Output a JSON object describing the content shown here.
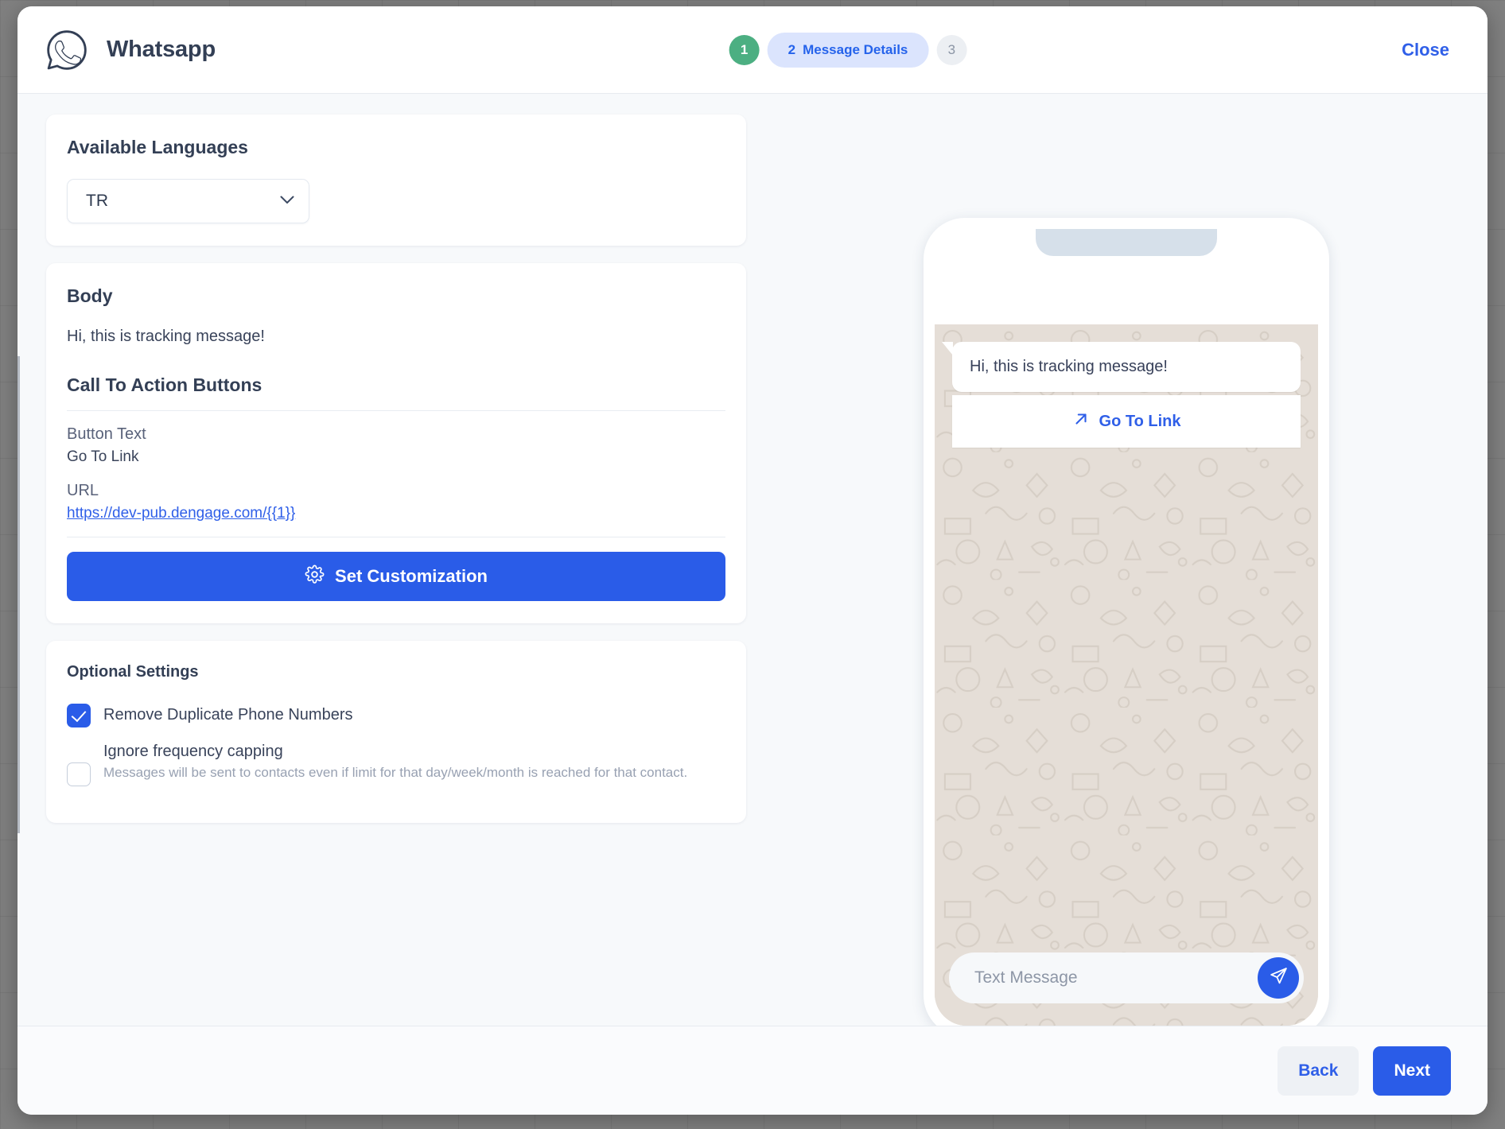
{
  "header": {
    "title": "Whatsapp",
    "logo_icon": "whatsapp-icon",
    "close_label": "Close",
    "steps": [
      {
        "number": "1",
        "label": "",
        "state": "done"
      },
      {
        "number": "2",
        "label": "Message Details",
        "state": "active"
      },
      {
        "number": "3",
        "label": "",
        "state": "idle"
      }
    ]
  },
  "languages": {
    "title": "Available Languages",
    "selected": "TR",
    "chevron_icon": "chevron-down-icon"
  },
  "body_card": {
    "title": "Body",
    "text": "Hi, this is tracking message!",
    "cta_heading": "Call To Action Buttons",
    "button_text_label": "Button Text",
    "button_text_value": "Go To Link",
    "url_label": "URL",
    "url_value": "https://dev-pub.dengage.com/{{1}}",
    "customization_button": "Set Customization",
    "customization_icon": "gear-icon"
  },
  "optional": {
    "title": "Optional Settings",
    "items": [
      {
        "label": "Remove Duplicate Phone Numbers",
        "sub": "",
        "checked": true
      },
      {
        "label": "Ignore frequency capping",
        "sub": "Messages will be sent to contacts even if limit for that day/week/month is reached for that contact.",
        "checked": false
      }
    ]
  },
  "preview": {
    "message": "Hi, this is tracking message!",
    "cta_label": "Go To Link",
    "cta_icon": "arrow-up-right-icon",
    "composer_placeholder": "Text Message",
    "send_icon": "send-icon"
  },
  "footer": {
    "back_label": "Back",
    "next_label": "Next"
  },
  "colors": {
    "primary": "#2a5ce8",
    "link": "#2f5fe8",
    "step_done": "#4caf82",
    "step_active_bg": "#dbe4fd",
    "chat_wallpaper": "#e5ded7",
    "heading": "#333f55"
  }
}
